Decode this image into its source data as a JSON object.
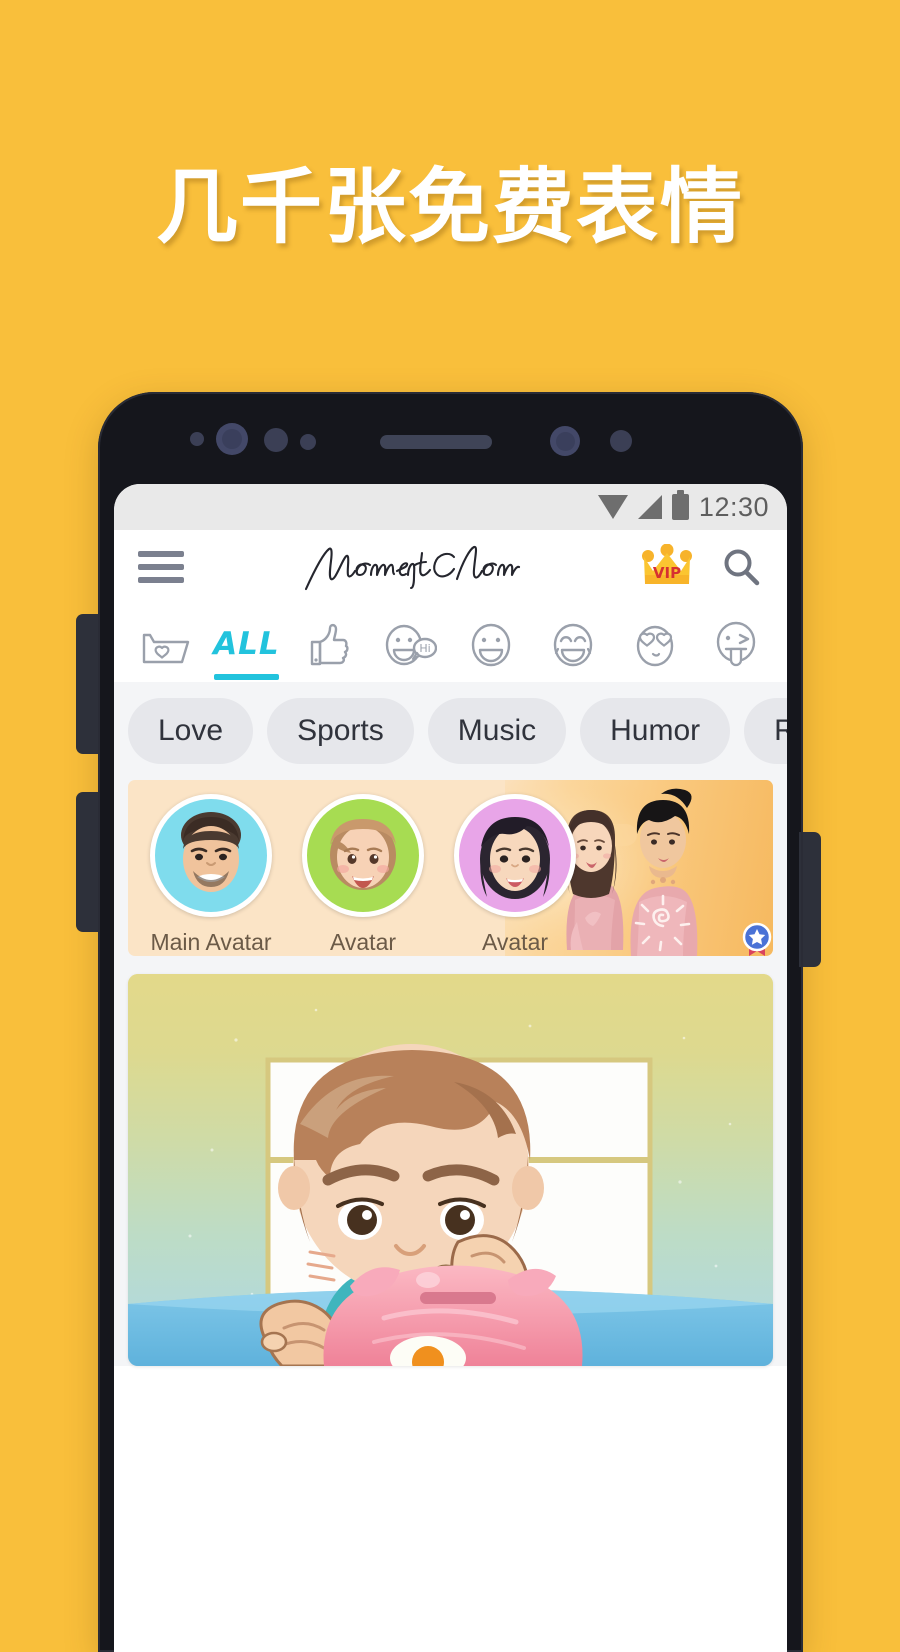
{
  "page": {
    "background_color": "#f9bf3b",
    "headline": "几千张免费表情"
  },
  "phone": {
    "frame_color": "#15161c",
    "hardware": {
      "volume_up": "volume-up-button",
      "volume_down": "volume-down-button",
      "power": "power-button",
      "speaker": "earpiece-speaker"
    }
  },
  "statusbar": {
    "time": "12:30",
    "icons": [
      "wifi-icon",
      "cellular-signal-icon",
      "battery-icon"
    ],
    "background_color": "#e9e9e9",
    "text_color": "#5e5e5e"
  },
  "appbar": {
    "menu_label": "menu",
    "logo_text": "MomentCam",
    "vip_label": "VIP",
    "search_label": "search",
    "accent_color": "#22c3dd"
  },
  "tabs": {
    "active_index": 1,
    "items": [
      {
        "label": "",
        "icon": "favorites-folder-icon",
        "active": false
      },
      {
        "label": "ALL",
        "icon": "all-text",
        "active": true
      },
      {
        "label": "",
        "icon": "thumbs-up-icon",
        "active": false
      },
      {
        "label": "",
        "icon": "face-hi-bubble-icon",
        "active": false
      },
      {
        "label": "",
        "icon": "smiling-face-icon",
        "active": false
      },
      {
        "label": "",
        "icon": "laughing-face-icon",
        "active": false
      },
      {
        "label": "",
        "icon": "heart-eyes-face-icon",
        "active": false
      },
      {
        "label": "",
        "icon": "tongue-out-face-icon",
        "active": false
      }
    ]
  },
  "chips": {
    "items": [
      {
        "label": "Love"
      },
      {
        "label": "Sports"
      },
      {
        "label": "Music"
      },
      {
        "label": "Humor"
      },
      {
        "label": "Rom"
      }
    ],
    "background_color": "#e6e7eb",
    "text_color": "#30333c"
  },
  "avatars": {
    "strip_background": "#fbe4c6",
    "items": [
      {
        "label": "Main Avatar",
        "bg_color": "#7fdced",
        "badge": "star-badge",
        "is_main": true
      },
      {
        "label": "Avatar",
        "bg_color": "#a7dc52",
        "badge": "",
        "is_main": false
      },
      {
        "label": "Avatar",
        "bg_color": "#e8a5e8",
        "badge": "",
        "is_main": false
      }
    ],
    "promo": "couple-caricature-banner"
  },
  "sticker": {
    "title": "child-with-piggy-bank-sticker",
    "background_gradient_top": "#e3d98a",
    "background_gradient_bottom": "#b2d9e2"
  }
}
